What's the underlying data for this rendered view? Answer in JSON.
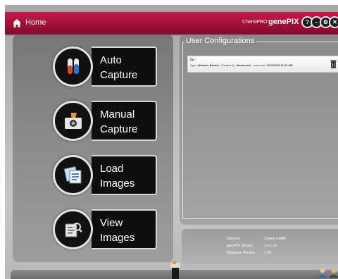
{
  "header": {
    "home_label": "Home",
    "brand_small": "ChemiPRO",
    "brand_main": "genePIX",
    "buttons": [
      {
        "name": "help",
        "glyph": "?"
      },
      {
        "name": "minimize",
        "glyph": "–"
      },
      {
        "name": "settings",
        "glyph": "⚙"
      },
      {
        "name": "close",
        "glyph": "✕"
      }
    ]
  },
  "tiles": [
    {
      "line1": "Auto",
      "line2": "Capture",
      "icon": "test-tubes-icon"
    },
    {
      "line1": "Manual",
      "line2": "Capture",
      "icon": "camera-icon"
    },
    {
      "line1": "Load",
      "line2": "Images",
      "icon": "image-stack-icon"
    },
    {
      "line1": "View",
      "line2": "Images",
      "icon": "magnifier-icon"
    }
  ],
  "configurations": {
    "title": "User Configurations",
    "items": [
      {
        "name": "DD",
        "type_label": "Type",
        "type_value": "Western Bicolor",
        "created_label": "Created by",
        "created_value": "dmanuvela",
        "last_label": "Last used",
        "last_value": "8/12/2010 11:21 AM"
      }
    ]
  },
  "info": {
    "camera_label": "Camera",
    "camera_value": "Cleavo 4.0MP",
    "version_label": "genePIX Version",
    "version_value": "1.6.1.13",
    "db_label": "Database Version",
    "db_value": "1.86"
  },
  "colors": {
    "accent": "#a0103a",
    "panel": "#8e8e8e"
  }
}
